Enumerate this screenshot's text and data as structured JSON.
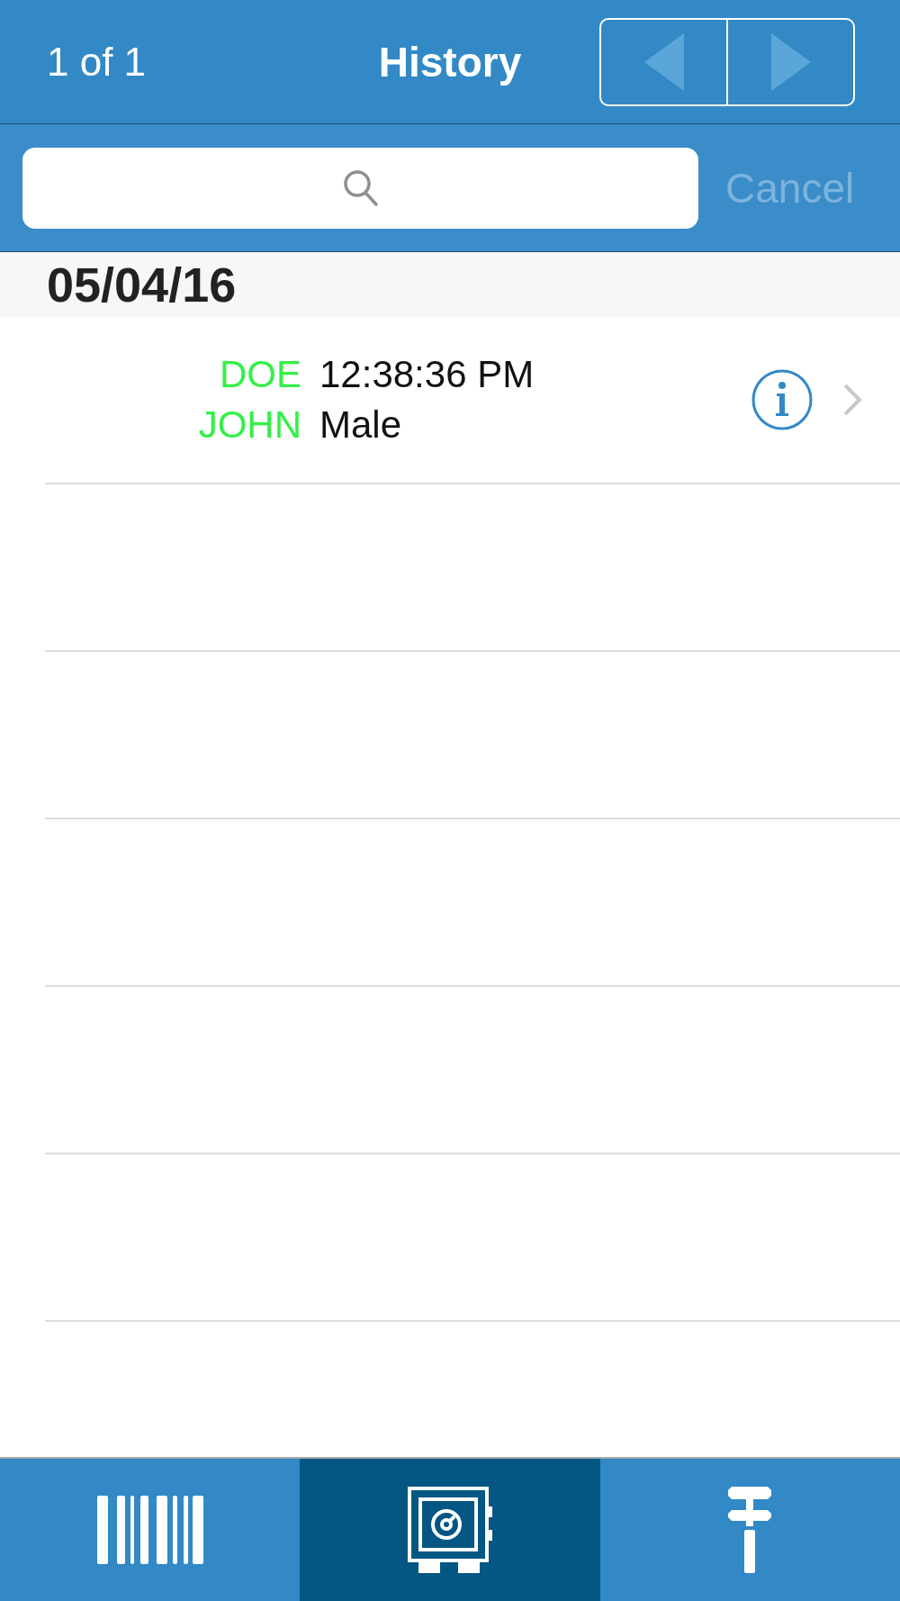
{
  "nav_bar": {
    "counter": "1 of 1",
    "title": "History",
    "pager": [
      {
        "kind": "prev",
        "disabled": true
      },
      {
        "kind": "next",
        "disabled": true
      }
    ]
  },
  "search": {
    "cancel": "Cancel"
  },
  "sections": [
    {
      "header": "05/04/16",
      "rows": [
        {
          "last_name": "DOE",
          "first_name": "JOHN",
          "color": "#33f046",
          "time": "12:38:36 PM",
          "sex": "Male"
        }
      ]
    }
  ],
  "tab_bar": [
    {
      "kind": "barcode",
      "selected": false
    },
    {
      "kind": "safe",
      "selected": true
    },
    {
      "kind": "wrench",
      "selected": false
    }
  ]
}
